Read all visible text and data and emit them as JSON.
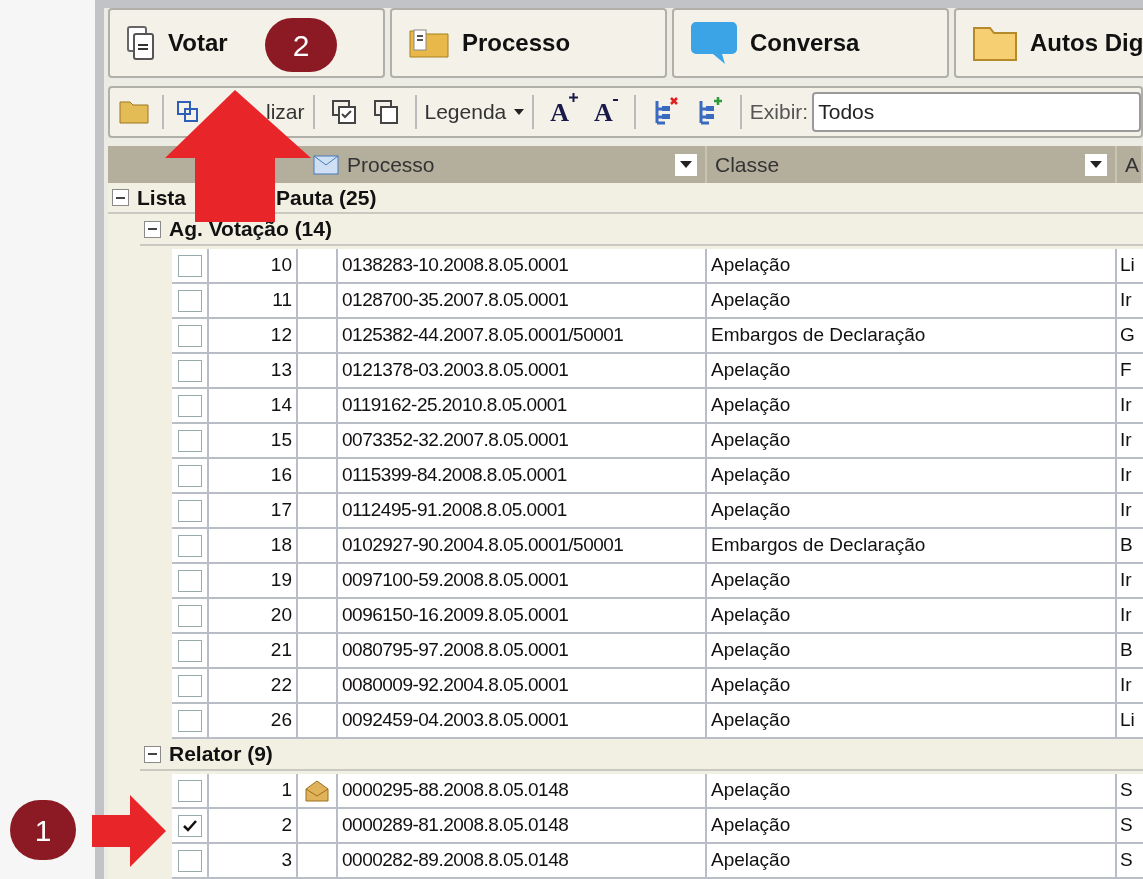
{
  "tabs": [
    {
      "kind": "document",
      "label": "Votar"
    },
    {
      "kind": "doc-folder",
      "label": "Processo"
    },
    {
      "kind": "chat",
      "label": "Conversa"
    },
    {
      "kind": "folder",
      "label": "Autos Dig"
    }
  ],
  "toolbar": {
    "refresh_label": "lizar",
    "legend_label": "Legenda",
    "font_up": "A",
    "font_down": "A",
    "show_label": "Exibir:",
    "show_value": "Todos"
  },
  "table": {
    "columns": [
      {
        "label": "Processo",
        "kind": "mail"
      },
      {
        "label": "Classe",
        "kind": "plain"
      },
      {
        "label": "A",
        "kind": "cut"
      }
    ],
    "root": {
      "label_start": "Lista",
      "label_end": "Pauta (25)",
      "expanded": true,
      "children": [
        {
          "label": "Ag. Votação (14)",
          "expanded": true,
          "rows": [
            {
              "num": "10",
              "processo": "0138283-10.2008.8.05.0001",
              "classe": "Apelação",
              "column_3": "Li",
              "checked": false,
              "mail": false
            },
            {
              "num": "11",
              "processo": "0128700-35.2007.8.05.0001",
              "classe": "Apelação",
              "column_3": "Ir",
              "checked": false,
              "mail": false
            },
            {
              "num": "12",
              "processo": "0125382-44.2007.8.05.0001/50001",
              "classe": "Embargos de Declaração",
              "column_3": "G",
              "checked": false,
              "mail": false
            },
            {
              "num": "13",
              "processo": "0121378-03.2003.8.05.0001",
              "classe": "Apelação",
              "column_3": "F",
              "checked": false,
              "mail": false
            },
            {
              "num": "14",
              "processo": "0119162-25.2010.8.05.0001",
              "classe": "Apelação",
              "column_3": "Ir",
              "checked": false,
              "mail": false
            },
            {
              "num": "15",
              "processo": "0073352-32.2007.8.05.0001",
              "classe": "Apelação",
              "column_3": "Ir",
              "checked": false,
              "mail": false
            },
            {
              "num": "16",
              "processo": "0115399-84.2008.8.05.0001",
              "classe": "Apelação",
              "column_3": "Ir",
              "checked": false,
              "mail": false
            },
            {
              "num": "17",
              "processo": "0112495-91.2008.8.05.0001",
              "classe": "Apelação",
              "column_3": "Ir",
              "checked": false,
              "mail": false
            },
            {
              "num": "18",
              "processo": "0102927-90.2004.8.05.0001/50001",
              "classe": "Embargos de Declaração",
              "column_3": "B",
              "checked": false,
              "mail": false
            },
            {
              "num": "19",
              "processo": "0097100-59.2008.8.05.0001",
              "classe": "Apelação",
              "column_3": "Ir",
              "checked": false,
              "mail": false
            },
            {
              "num": "20",
              "processo": "0096150-16.2009.8.05.0001",
              "classe": "Apelação",
              "column_3": "Ir",
              "checked": false,
              "mail": false
            },
            {
              "num": "21",
              "processo": "0080795-97.2008.8.05.0001",
              "classe": "Apelação",
              "column_3": "B",
              "checked": false,
              "mail": false
            },
            {
              "num": "22",
              "processo": "0080009-92.2004.8.05.0001",
              "classe": "Apelação",
              "column_3": "Ir",
              "checked": false,
              "mail": false
            },
            {
              "num": "26",
              "processo": "0092459-04.2003.8.05.0001",
              "classe": "Apelação",
              "column_3": "Li",
              "checked": false,
              "mail": false
            }
          ]
        },
        {
          "label": "Relator (9)",
          "expanded": true,
          "rows": [
            {
              "num": "1",
              "processo": "0000295-88.2008.8.05.0148",
              "classe": "Apelação",
              "column_3": "S",
              "checked": false,
              "mail": true
            },
            {
              "num": "2",
              "processo": "0000289-81.2008.8.05.0148",
              "classe": "Apelação",
              "column_3": "S",
              "checked": true,
              "mail": false
            },
            {
              "num": "3",
              "processo": "0000282-89.2008.8.05.0148",
              "classe": "Apelação",
              "column_3": "S",
              "checked": false,
              "mail": false
            }
          ]
        }
      ]
    }
  },
  "annotations": [
    {
      "label": "2",
      "kind": "up"
    },
    {
      "label": "1",
      "kind": "right"
    }
  ]
}
